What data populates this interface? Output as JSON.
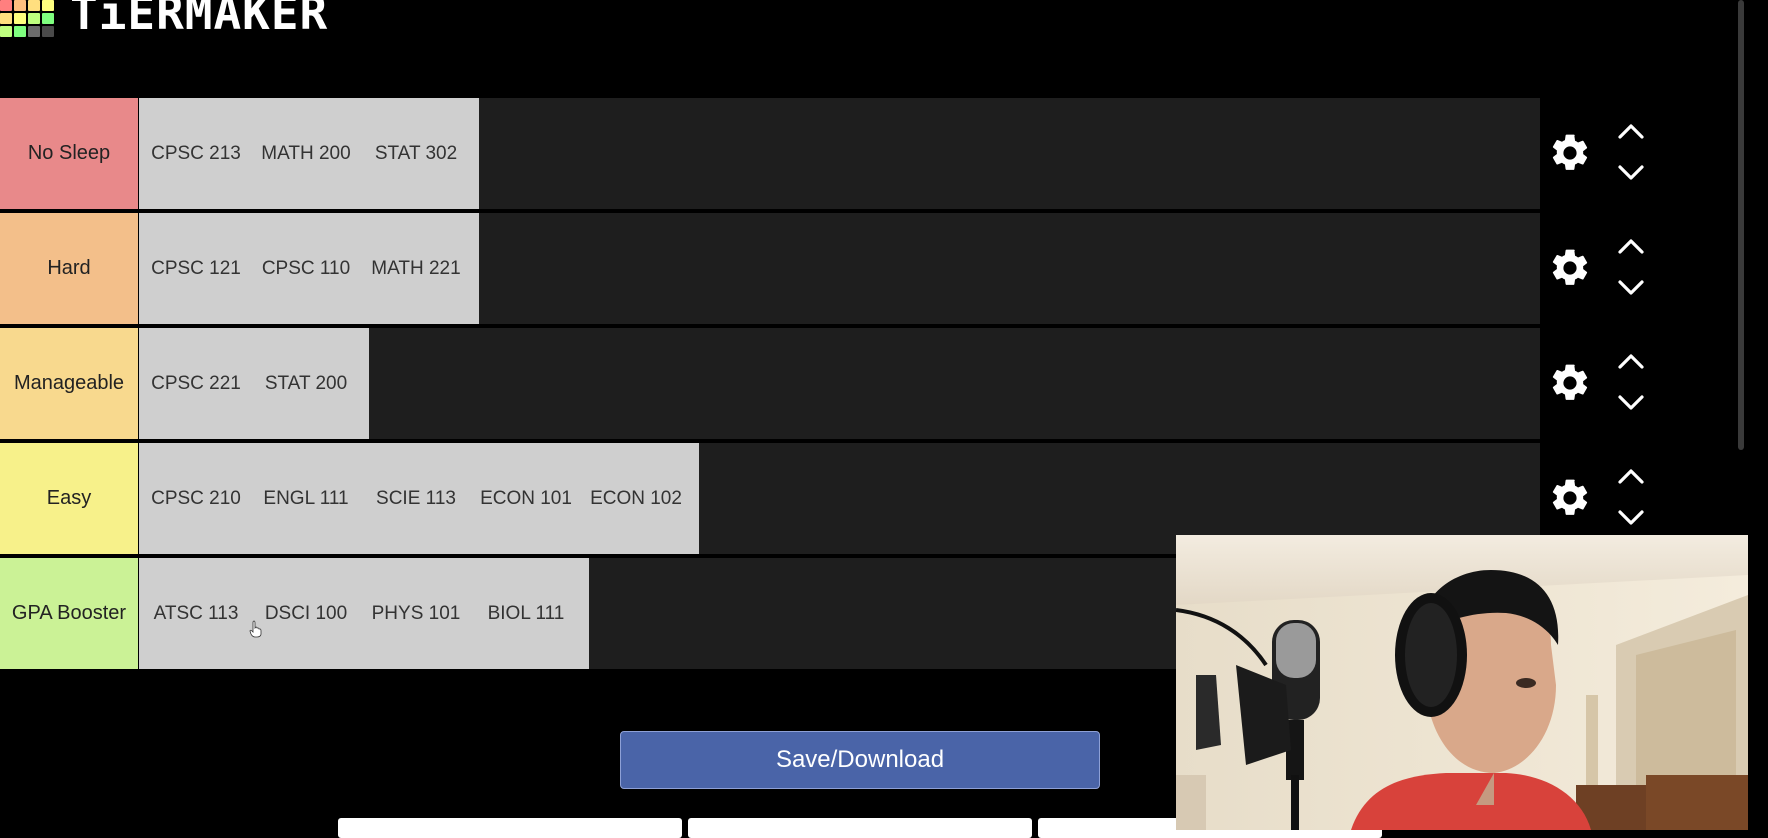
{
  "brand": {
    "name": "TiERMAKER"
  },
  "tiers": [
    {
      "label": "No Sleep",
      "color": "#e8898a",
      "items": [
        "CPSC 213",
        "MATH 200",
        "STAT 302"
      ]
    },
    {
      "label": "Hard",
      "color": "#f3bf8a",
      "items": [
        "CPSC 121",
        "CPSC 110",
        "MATH 221"
      ]
    },
    {
      "label": "Manageable",
      "color": "#f8d98e",
      "items": [
        "CPSC 221",
        "STAT 200"
      ]
    },
    {
      "label": "Easy",
      "color": "#f7f18a",
      "items": [
        "CPSC 210",
        "ENGL 111",
        "SCIE 113",
        "ECON 101",
        "ECON 102"
      ]
    },
    {
      "label": "GPA Booster",
      "color": "#cbf296",
      "items": [
        "ATSC 113",
        "DSCI 100",
        "PHYS 101",
        "BIOL 111"
      ]
    }
  ],
  "actions": {
    "save_label": "Save/Download"
  },
  "icons": {
    "settings": "gear-icon",
    "move_up": "chevron-up-icon",
    "move_down": "chevron-down-icon"
  }
}
